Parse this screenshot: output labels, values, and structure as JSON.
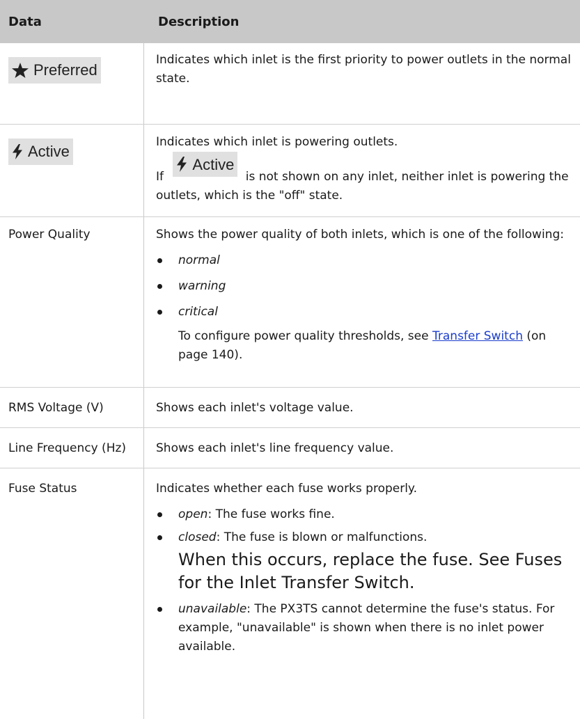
{
  "header": {
    "col1": "Data",
    "col2": "Description"
  },
  "rows": {
    "preferred": {
      "chip_label": "Preferred",
      "icon": "star-icon",
      "desc": "Indicates which inlet is the first priority to power outlets in the normal state."
    },
    "active": {
      "chip_label": "Active",
      "icon": "lightning-icon",
      "desc": "Indicates which inlet is powering outlets.",
      "note_prefix": "If",
      "note_suffix": "is not shown on any inlet, neither inlet is powering the outlets, which is the \"off\" state."
    },
    "power_quality": {
      "label": "Power Quality",
      "desc": "Shows the power quality of both inlets, which is one of the following:",
      "items": [
        "normal",
        "warning",
        "critical"
      ],
      "note_prefix": "To configure power quality thresholds, see",
      "note_link": "Transfer Switch",
      "note_suffix": "(on page 140)."
    },
    "rms_voltage": {
      "label": "RMS Voltage (V)",
      "desc": "Shows each inlet's voltage value."
    },
    "line_frequency": {
      "label": "Line Frequency (Hz)",
      "desc": "Shows each inlet's line frequency value."
    },
    "fuse_status": {
      "label": "Fuse Status",
      "desc": "Indicates whether each fuse works properly.",
      "open_term": "open",
      "open_desc": ": The fuse works fine.",
      "closed_term": "closed",
      "closed_desc": ": The fuse is blown or malfunctions.",
      "closed_note": "When this occurs, replace the fuse. See Fuses for the Inlet Transfer Switch.",
      "unavailable_term": "unavailable",
      "unavailable_desc": ": The PX3TS cannot determine the fuse's status. For example, \"unavailable\" is shown when there is no inlet power available."
    }
  }
}
